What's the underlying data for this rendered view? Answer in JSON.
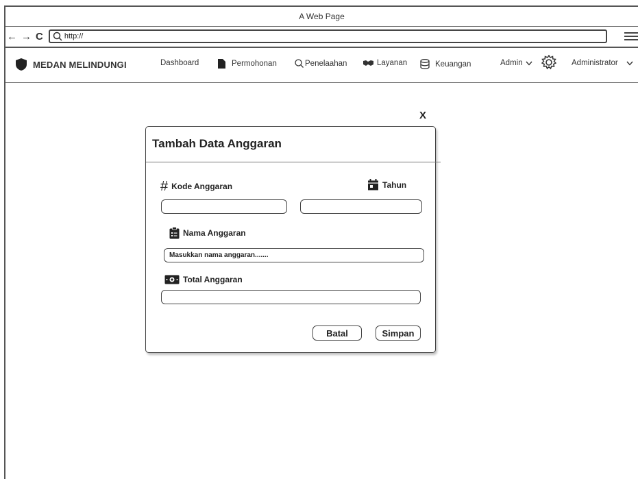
{
  "browser": {
    "title": "A Web Page",
    "url": "http://"
  },
  "nav": {
    "brand": "MEDAN MELINDUNGI",
    "items": [
      "Dashboard",
      "Permohonan",
      "Penelaahan",
      "Layanan",
      "Keuangan"
    ],
    "admin_menu": "Admin",
    "user_menu": "Administrator"
  },
  "modal": {
    "close_label": "X",
    "title": "Tambah Data Anggaran",
    "fields": {
      "kode_label": "Kode Anggaran",
      "tahun_label": "Tahun",
      "nama_label": "Nama Anggaran",
      "nama_value": "Masukkan nama anggaran.......",
      "total_label": "Total Anggaran"
    },
    "buttons": {
      "cancel": "Batal",
      "save": "Simpan"
    }
  },
  "icons": [
    "shield-icon",
    "file-icon",
    "search-icon",
    "handshake-icon",
    "database-icon",
    "gear-icon",
    "chevron-down-icon",
    "hash-icon",
    "calendar-icon",
    "clipboard-icon",
    "money-icon"
  ]
}
